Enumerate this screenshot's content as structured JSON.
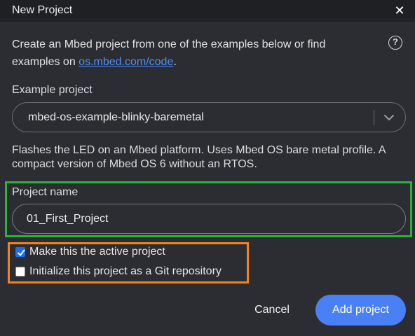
{
  "dialog": {
    "title": "New Project",
    "close_glyph": "✕"
  },
  "intro": {
    "text_before": "Create an Mbed project from one of the examples below or find examples on ",
    "link": "os.mbed.com/code",
    "text_after": ".",
    "help_glyph": "?"
  },
  "example": {
    "label": "Example project",
    "selected": "mbed-os-example-blinky-baremetal",
    "description": "Flashes the LED on an Mbed platform. Uses Mbed OS bare metal profile. A compact version of Mbed OS 6 without an RTOS."
  },
  "project_name": {
    "label": "Project name",
    "value": "01_First_Project"
  },
  "options": {
    "active_label": "Make this the active project",
    "active_checked": true,
    "git_label": "Initialize this project as a Git repository",
    "git_checked": false
  },
  "buttons": {
    "cancel": "Cancel",
    "add": "Add project"
  },
  "colors": {
    "accent": "#4a80f6",
    "link": "#4e8ef7",
    "highlight_green": "#2bb23c",
    "highlight_orange": "#f0831f",
    "background": "#2b2d33",
    "titlebar": "#1f2024"
  },
  "icons": {
    "help": "help-circle-icon",
    "close": "close-icon",
    "dropdown": "chevron-down-icon"
  }
}
